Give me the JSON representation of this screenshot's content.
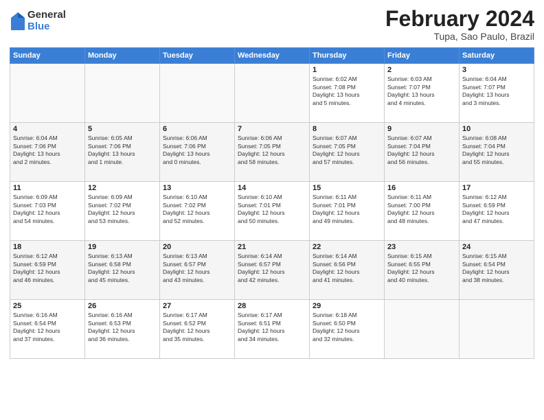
{
  "logo": {
    "general": "General",
    "blue": "Blue"
  },
  "header": {
    "title": "February 2024",
    "subtitle": "Tupa, Sao Paulo, Brazil"
  },
  "weekdays": [
    "Sunday",
    "Monday",
    "Tuesday",
    "Wednesday",
    "Thursday",
    "Friday",
    "Saturday"
  ],
  "rows": [
    [
      {
        "day": "",
        "info": ""
      },
      {
        "day": "",
        "info": ""
      },
      {
        "day": "",
        "info": ""
      },
      {
        "day": "",
        "info": ""
      },
      {
        "day": "1",
        "info": "Sunrise: 6:02 AM\nSunset: 7:08 PM\nDaylight: 13 hours\nand 5 minutes."
      },
      {
        "day": "2",
        "info": "Sunrise: 6:03 AM\nSunset: 7:07 PM\nDaylight: 13 hours\nand 4 minutes."
      },
      {
        "day": "3",
        "info": "Sunrise: 6:04 AM\nSunset: 7:07 PM\nDaylight: 13 hours\nand 3 minutes."
      }
    ],
    [
      {
        "day": "4",
        "info": "Sunrise: 6:04 AM\nSunset: 7:06 PM\nDaylight: 13 hours\nand 2 minutes."
      },
      {
        "day": "5",
        "info": "Sunrise: 6:05 AM\nSunset: 7:06 PM\nDaylight: 13 hours\nand 1 minute."
      },
      {
        "day": "6",
        "info": "Sunrise: 6:06 AM\nSunset: 7:06 PM\nDaylight: 13 hours\nand 0 minutes."
      },
      {
        "day": "7",
        "info": "Sunrise: 6:06 AM\nSunset: 7:05 PM\nDaylight: 12 hours\nand 58 minutes."
      },
      {
        "day": "8",
        "info": "Sunrise: 6:07 AM\nSunset: 7:05 PM\nDaylight: 12 hours\nand 57 minutes."
      },
      {
        "day": "9",
        "info": "Sunrise: 6:07 AM\nSunset: 7:04 PM\nDaylight: 12 hours\nand 56 minutes."
      },
      {
        "day": "10",
        "info": "Sunrise: 6:08 AM\nSunset: 7:04 PM\nDaylight: 12 hours\nand 55 minutes."
      }
    ],
    [
      {
        "day": "11",
        "info": "Sunrise: 6:09 AM\nSunset: 7:03 PM\nDaylight: 12 hours\nand 54 minutes."
      },
      {
        "day": "12",
        "info": "Sunrise: 6:09 AM\nSunset: 7:02 PM\nDaylight: 12 hours\nand 53 minutes."
      },
      {
        "day": "13",
        "info": "Sunrise: 6:10 AM\nSunset: 7:02 PM\nDaylight: 12 hours\nand 52 minutes."
      },
      {
        "day": "14",
        "info": "Sunrise: 6:10 AM\nSunset: 7:01 PM\nDaylight: 12 hours\nand 50 minutes."
      },
      {
        "day": "15",
        "info": "Sunrise: 6:11 AM\nSunset: 7:01 PM\nDaylight: 12 hours\nand 49 minutes."
      },
      {
        "day": "16",
        "info": "Sunrise: 6:11 AM\nSunset: 7:00 PM\nDaylight: 12 hours\nand 48 minutes."
      },
      {
        "day": "17",
        "info": "Sunrise: 6:12 AM\nSunset: 6:59 PM\nDaylight: 12 hours\nand 47 minutes."
      }
    ],
    [
      {
        "day": "18",
        "info": "Sunrise: 6:12 AM\nSunset: 6:59 PM\nDaylight: 12 hours\nand 46 minutes."
      },
      {
        "day": "19",
        "info": "Sunrise: 6:13 AM\nSunset: 6:58 PM\nDaylight: 12 hours\nand 45 minutes."
      },
      {
        "day": "20",
        "info": "Sunrise: 6:13 AM\nSunset: 6:57 PM\nDaylight: 12 hours\nand 43 minutes."
      },
      {
        "day": "21",
        "info": "Sunrise: 6:14 AM\nSunset: 6:57 PM\nDaylight: 12 hours\nand 42 minutes."
      },
      {
        "day": "22",
        "info": "Sunrise: 6:14 AM\nSunset: 6:56 PM\nDaylight: 12 hours\nand 41 minutes."
      },
      {
        "day": "23",
        "info": "Sunrise: 6:15 AM\nSunset: 6:55 PM\nDaylight: 12 hours\nand 40 minutes."
      },
      {
        "day": "24",
        "info": "Sunrise: 6:15 AM\nSunset: 6:54 PM\nDaylight: 12 hours\nand 38 minutes."
      }
    ],
    [
      {
        "day": "25",
        "info": "Sunrise: 6:16 AM\nSunset: 6:54 PM\nDaylight: 12 hours\nand 37 minutes."
      },
      {
        "day": "26",
        "info": "Sunrise: 6:16 AM\nSunset: 6:53 PM\nDaylight: 12 hours\nand 36 minutes."
      },
      {
        "day": "27",
        "info": "Sunrise: 6:17 AM\nSunset: 6:52 PM\nDaylight: 12 hours\nand 35 minutes."
      },
      {
        "day": "28",
        "info": "Sunrise: 6:17 AM\nSunset: 6:51 PM\nDaylight: 12 hours\nand 34 minutes."
      },
      {
        "day": "29",
        "info": "Sunrise: 6:18 AM\nSunset: 6:50 PM\nDaylight: 12 hours\nand 32 minutes."
      },
      {
        "day": "",
        "info": ""
      },
      {
        "day": "",
        "info": ""
      }
    ]
  ]
}
